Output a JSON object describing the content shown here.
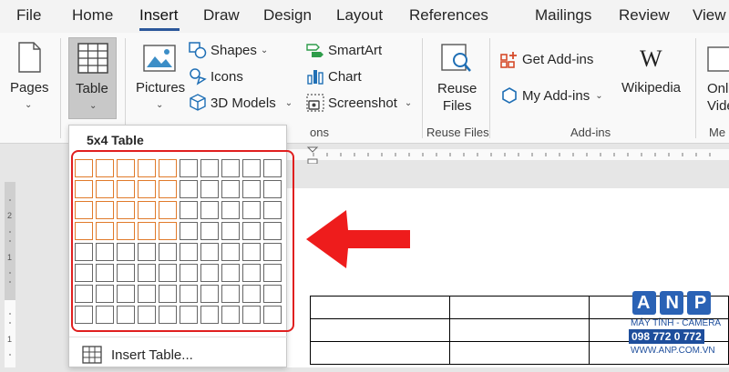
{
  "tabs": [
    "File",
    "Home",
    "Insert",
    "Draw",
    "Design",
    "Layout",
    "References",
    "Mailings",
    "Review",
    "View"
  ],
  "active_tab": "Insert",
  "ribbon": {
    "pages": "Pages",
    "table": "Table",
    "pictures": "Pictures",
    "shapes": "Shapes",
    "icons": "Icons",
    "models_3d": "3D Models",
    "smartart": "SmartArt",
    "chart": "Chart",
    "screenshot": "Screenshot",
    "reuse_files": "Reuse\nFiles",
    "reuse_files_group": "Reuse Files",
    "get_addins": "Get Add-ins",
    "my_addins": "My Add-ins",
    "wikipedia": "Wikipedia",
    "addins_group": "Add-ins",
    "online_video_partial": "Onl\nVide",
    "media_group_partial": "Me",
    "illustrations_group_partial": "ons"
  },
  "table_dropdown": {
    "title": "5x4 Table",
    "grid_columns": 10,
    "grid_rows": 8,
    "selected_columns": 5,
    "selected_rows": 4,
    "insert_table": "Insert Table..."
  },
  "watermark": {
    "brand": "ANP",
    "tagline": "MÁY TÍNH - CAMERA",
    "phone": "098 772 0 772",
    "url": "WWW.ANP.COM.VN"
  },
  "colors": {
    "accent": "#2b579a",
    "selection": "#e07a2a",
    "highlight_red": "#e01f1f",
    "brand_blue": "#1e4e9c"
  }
}
